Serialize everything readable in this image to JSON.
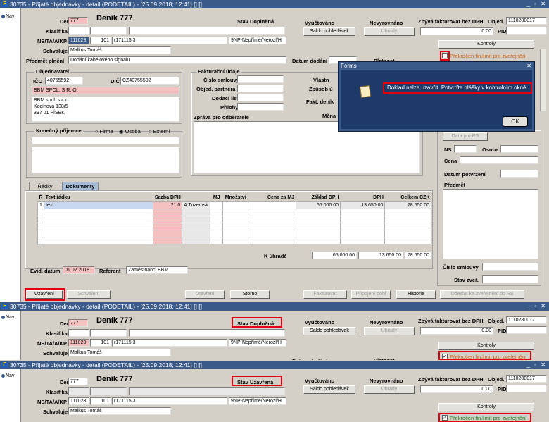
{
  "win1": {
    "title": "30735 - Přijaté objednávky - detail (PODETAIL) - [25.09.2018; 12:41] [] []",
    "controls": "_ ▫ ✕"
  },
  "win2": {
    "title": "30735 - Přijaté objednávky - detail (PODETAIL) - [25.09.2018; 12:41] [] []",
    "controls": "_ ▫ ✕"
  },
  "win3": {
    "title": "30735 - Přijaté objednávky - detail (PODETAIL) - [25.09.2018; 12:41] [] []",
    "controls": "_ ▫ ✕"
  },
  "nav": {
    "label": "Nav"
  },
  "header": {
    "denik_label": "Deník",
    "denik_value": "777",
    "denik_title": "Deník 777",
    "klasifikace_label": "Klasifikace",
    "ns_label": "NS/TA/A/KP",
    "ns_value": "111023",
    "ta_value": "101",
    "a_value": "r171115.3",
    "kp_value": "9NP-Nepřímé/Nerozl/H",
    "schvaluje_label": "Schvaluje",
    "schvaluje_value": "Malkus Tomáš",
    "predmet_label": "Předmět plnění",
    "predmet_value": "Dodání kabelového signálu",
    "stav_label": "Stav",
    "stav_value1": "Doplněná",
    "stav_value3": "Uzavřená",
    "vyuctovano": "Vyúčtováno",
    "saldo_btn": "Saldo pohledávek",
    "nevyrovnano": "Nevyrovnáno",
    "uhrady_btn": "Úhrady",
    "zbyva_label": "Zbývá fakturovat bez DPH",
    "zbyva_value": "0.00",
    "objed_label": "Objed.",
    "objed_value": "1110280017",
    "pid_label": "PID",
    "kontroly_btn": "Kontroly",
    "prekrocen": "Překročen fin.limit pro zveřejnění",
    "datum_dodani": "Datum dodání",
    "platnost": "Platnost"
  },
  "objednavatel": {
    "title": "Objednavatel",
    "ico_label": "IČO",
    "ico_value": "40755592",
    "dic_label": "DIČ",
    "dic_value": "CZ40755592",
    "name": "BBM SPOL. S R. O.",
    "addr1": "BBM spol. s r. o.",
    "addr2": "Kocínova 138/5",
    "addr3": "397 01  PÍSEK"
  },
  "prijemce": {
    "title": "Konečný příjemce",
    "opt1": "Firma",
    "opt2": "Osoba",
    "opt3": "Externí"
  },
  "fakturace": {
    "title": "Fakturační údaje",
    "cislo": "Číslo smlouvy",
    "partner": "Objed. partnera",
    "dodaci": "Dodací list",
    "prilohy": "Přílohy",
    "zprava": "Zpráva pro odběratele",
    "vlastn": "Vlastn",
    "zpusob": "Způsob ú",
    "fakt_denik": "Fakt. deník",
    "mena": "Měna"
  },
  "dialog": {
    "title": "Forms",
    "message": "Doklad nelze uzavřít. Potvrďte hlášky v kontrolním okně.",
    "ok": "OK",
    "controls": "✕"
  },
  "rightpanel": {
    "data_btn": "Data pro RS",
    "ns": "NS",
    "osoba": "Osoba",
    "cena": "Cena",
    "datum_potvrzeni": "Datum potvrzení",
    "predmet": "Předmět",
    "cislo_smlouvy": "Číslo smlouvy",
    "stav_zver": "Stav zveř."
  },
  "tabs": {
    "radky": "Řádky",
    "dokumenty": "Dokumenty"
  },
  "grid": {
    "headers": [
      "Ř",
      "Text řádku",
      "Sazba DPH",
      "MJ",
      "Množství",
      "Cena za MJ",
      "Základ DPH",
      "DPH",
      "Celkem  CZK"
    ],
    "row1": {
      "r": "1",
      "text": "text",
      "sazba": "21.0",
      "typ": "A  Tuzemsk",
      "zaklad": "65 000.00",
      "dph": "13 650.00",
      "celkem": "78 650.00"
    },
    "k_uhrade": "K úhradě",
    "sum_zaklad": "65 000.00",
    "sum_dph": "13 650.00",
    "sum_celkem": "78 650.00"
  },
  "evid": {
    "label": "Evid. datum",
    "value": "01.02.2018",
    "ref_label": "Referent",
    "ref_value": "Zaměstnanci BBM"
  },
  "buttons": {
    "uzavreni": "Uzavření",
    "schvaleni": "Schválení",
    "otevreni": "Otevření",
    "storno": "Storno",
    "fakturovat": "Fakturovat",
    "pripojeni": "Připojení pohl",
    "historie": "Historie",
    "odeslat": "Odeslat ke zveřejnění do RS"
  }
}
